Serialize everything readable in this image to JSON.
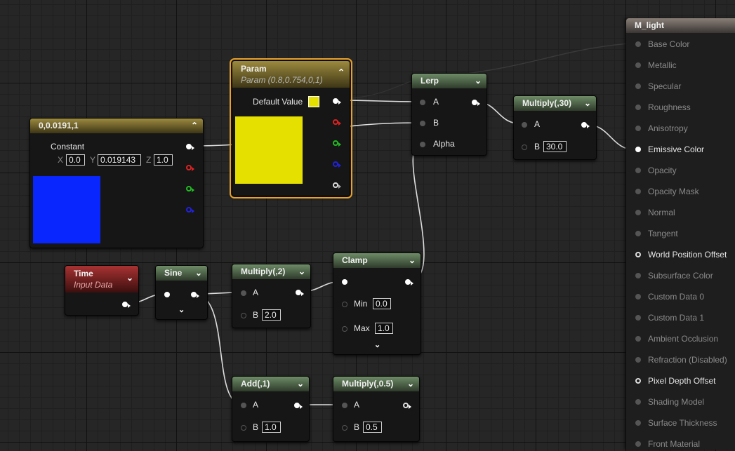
{
  "nodes": {
    "constant": {
      "title": "0,0.0191,1",
      "label": "Constant",
      "x_label": "X",
      "x_value": "0.0",
      "y_label": "Y",
      "y_value": "0.019143",
      "z_label": "Z",
      "z_value": "1.0",
      "color": "#0a26ff"
    },
    "param": {
      "title": "Param",
      "subtitle": "Param (0.8,0.754,0,1)",
      "default_label": "Default Value",
      "color": "#e5e000"
    },
    "lerp": {
      "title": "Lerp",
      "pin_a": "A",
      "pin_b": "B",
      "pin_alpha": "Alpha"
    },
    "multiply30": {
      "title": "Multiply(,30)",
      "pin_a": "A",
      "pin_b": "B",
      "b_value": "30.0"
    },
    "time": {
      "title": "Time",
      "subtitle": "Input Data"
    },
    "sine": {
      "title": "Sine"
    },
    "multiply2": {
      "title": "Multiply(,2)",
      "pin_a": "A",
      "pin_b": "B",
      "b_value": "2.0"
    },
    "clamp": {
      "title": "Clamp",
      "min_label": "Min",
      "min_value": "0.0",
      "max_label": "Max",
      "max_value": "1.0"
    },
    "add1": {
      "title": "Add(,1)",
      "pin_a": "A",
      "pin_b": "B",
      "b_value": "1.0"
    },
    "multiply05": {
      "title": "Multiply(,0.5)",
      "pin_a": "A",
      "pin_b": "B",
      "b_value": "0.5"
    }
  },
  "material": {
    "title": "M_light",
    "inputs": [
      {
        "label": "Base Color",
        "active": false
      },
      {
        "label": "Metallic",
        "active": false
      },
      {
        "label": "Specular",
        "active": false
      },
      {
        "label": "Roughness",
        "active": false
      },
      {
        "label": "Anisotropy",
        "active": false
      },
      {
        "label": "Emissive Color",
        "active": true,
        "connected": true
      },
      {
        "label": "Opacity",
        "active": false
      },
      {
        "label": "Opacity Mask",
        "active": false
      },
      {
        "label": "Normal",
        "active": false
      },
      {
        "label": "Tangent",
        "active": false
      },
      {
        "label": "World Position Offset",
        "active": true,
        "connected": false
      },
      {
        "label": "Subsurface Color",
        "active": false
      },
      {
        "label": "Custom Data 0",
        "active": false
      },
      {
        "label": "Custom Data 1",
        "active": false
      },
      {
        "label": "Ambient Occlusion",
        "active": false
      },
      {
        "label": "Refraction (Disabled)",
        "active": false
      },
      {
        "label": "Pixel Depth Offset",
        "active": true,
        "connected": false
      },
      {
        "label": "Shading Model",
        "active": false
      },
      {
        "label": "Surface Thickness",
        "active": false
      },
      {
        "label": "Front Material",
        "active": false
      }
    ]
  },
  "icons": {
    "collapse": "chevron-up-icon",
    "menu": "chevron-down-icon"
  }
}
